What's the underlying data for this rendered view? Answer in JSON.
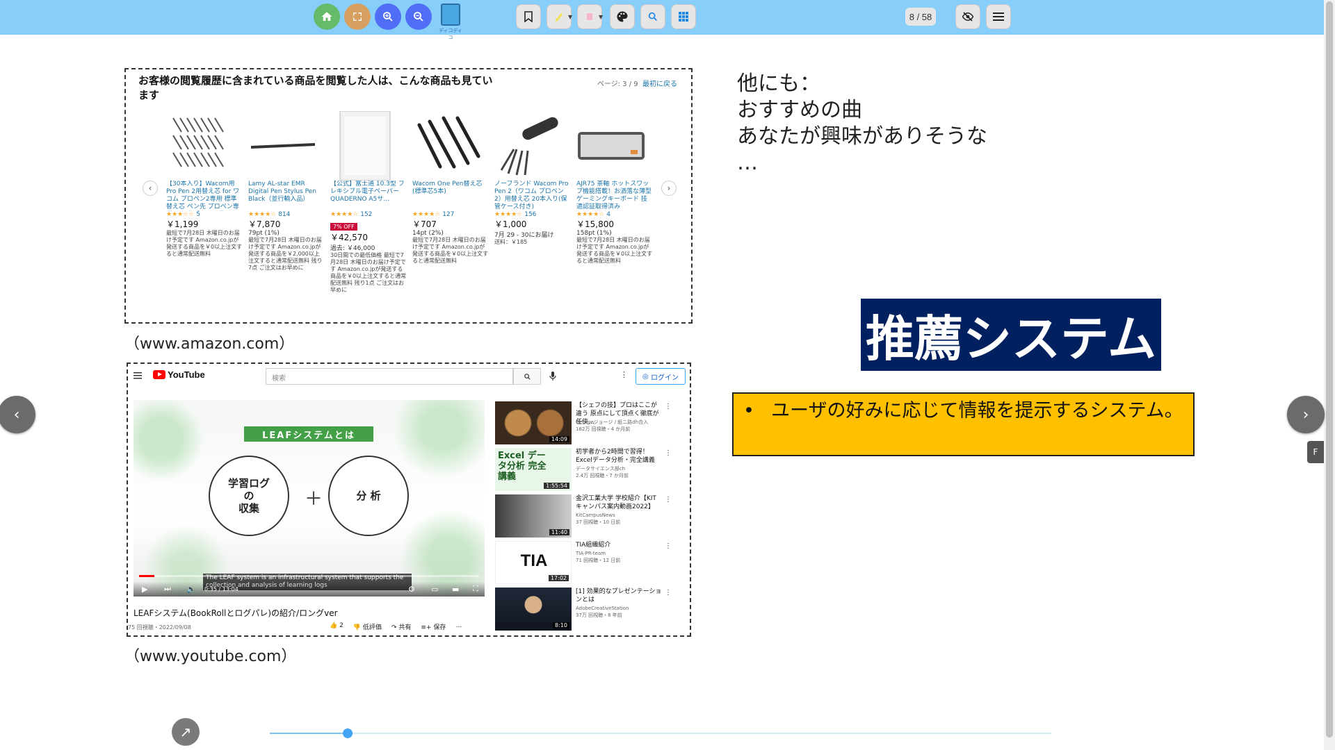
{
  "toolbar": {
    "home_icon": "home-icon",
    "fullscreen_icon": "fullscreen-icon",
    "zoom_in_icon": "zoom-in-icon",
    "zoom_out_icon": "zoom-out-icon",
    "logo_text": "ディコディコ",
    "page_indicator": "8 / 58",
    "colors": {
      "bar": "#87cefa",
      "home": "#66bb6a",
      "fullscreen": "#d8a060",
      "zoom": "#4f6df5"
    }
  },
  "amazon": {
    "heading": "お客様の閲覧履歴に含まれている商品を閲覧した人は、こんな商品も見ています",
    "page_label": "ページ: 3 / 9",
    "back_link": "最初に戻る",
    "items": [
      {
        "name": "【30本入り】Wacom用 Pro Pen 2用替え芯 for ワコム プロペン2専用 標準 替え芯 ペン先 プロペン専用 ペンタブレット用…",
        "stars": "★★★☆☆",
        "reviews": "5",
        "price": "￥1,199",
        "points": "",
        "notes": "最短で7月28日 木曜日のお届け予定です Amazon.co.jpが発送する商品を￥0以上注文すると通常配送無料"
      },
      {
        "name": "Lamy AL-star EMR Digital Pen Stylus Pen Black（並行輸入品）",
        "stars": "★★★★☆",
        "reviews": "814",
        "price": "￥7,870",
        "points": "79pt (1%)",
        "notes": "最短で7月28日 木曜日のお届け予定です Amazon.co.jpが発送する商品を￥2,000以上注文すると通常配送無料 残り7点 ご注文はお早めに"
      },
      {
        "name": "【公式】富士通 10.3型 フレキシブル電子ペーパー QUADERNO A5サ…",
        "stars": "★★★★☆",
        "reviews": "152",
        "badge": "7% OFF",
        "price": "￥42,570",
        "points": "過去: ￥46,000",
        "notes": "30日間での最低価格 最短で7月28日 木曜日のお届け予定です Amazon.co.jpが発送する商品を￥0以上注文すると通常配送無料 残り1点 ご注文はお早めに"
      },
      {
        "name": "Wacom One Pen替え芯 (標準芯5本)",
        "stars": "★★★★☆",
        "reviews": "127",
        "price": "￥707",
        "points": "14pt (2%)",
        "notes": "最短で7月28日 木曜日のお届け予定です Amazon.co.jpが発送する商品を￥0以上注文すると通常配送無料"
      },
      {
        "name": "ノーブランド Wacom Pro Pen 2（ワコム プロペン 2）用替え芯 20本入り(保管ケース付き)",
        "stars": "★★★★☆",
        "reviews": "156",
        "price": "￥1,000",
        "points": "7月 29 - 30にお届け",
        "notes": "送料：￥185"
      },
      {
        "name": "AJR75 茶軸 ホットスワップ機能搭載！お洒落な薄型ゲーミングキーボード 技適認証取得済み",
        "stars": "★★★★☆",
        "reviews": "4",
        "price": "￥15,800",
        "points": "158pt (1%)",
        "notes": "最短で7月28日 木曜日のお届け予定です Amazon.co.jpが発送する商品を￥0以上注文すると通常配送無料"
      }
    ],
    "caption": "（www.amazon.com）"
  },
  "youtube": {
    "logo": "YouTube",
    "search_placeholder": "検索",
    "login": "ログイン",
    "slide_band": "LEAFシステムとは",
    "circle_left": "学習ログ\nの\n収集",
    "plus": "＋",
    "circle_right": "分 析",
    "subtitle": "The LEAF system is an infrastructural system that supports the collection and analysis of learning logs",
    "time": "0:35 / 13:04",
    "progress": 0.045,
    "video_title": "LEAFシステム(BookRollとログパレ)の紹介/ロングver",
    "views_date": "75 回視聴・2022/09/08",
    "actions": {
      "like": "2",
      "dislike": "低評価",
      "share": "共有",
      "save": "保存",
      "more": "…"
    },
    "related": [
      {
        "title": "【シェフの技】プロはここが違う 原点にして頂点く徹底が任侠…",
        "channel": "Georgeジョージ / 紙ニ路dh合入",
        "stats": "182万 回視聴・4 か月前",
        "duration": "14:09"
      },
      {
        "title": "初学者から2時間で習得！Excelデータ分析・完全講義",
        "channel": "データサイエンス部ch",
        "stats": "2.4万 回視聴・7 か月前",
        "duration": "1:55:54",
        "thumb_text": "Excel データ分析 完全講義"
      },
      {
        "title": "金沢工業大学 学校紹介【KITキャンパス案内動画2022】",
        "channel": "KitCampusNews",
        "stats": "37 回視聴・10 日前",
        "duration": "11:40"
      },
      {
        "title": "TIA組織紹介",
        "channel": "TIA-PR-team",
        "stats": "71 回視聴・12 日前",
        "duration": "17:02",
        "thumb_text": "TIA"
      },
      {
        "title": "[1] 効果的なプレゼンテーションとは",
        "channel": "AdobeCreativeStation",
        "stats": "37万 回視聴・8 年前",
        "duration": "8:10"
      }
    ],
    "caption": "（www.youtube.com）"
  },
  "slide": {
    "others_lines": [
      "他にも：",
      "おすすめの曲",
      "あなたが興味がありそうな",
      "…"
    ],
    "title": "推薦システム",
    "bullet": "•",
    "definition": "ユーザの好みに応じて情報を提示するシステム。"
  },
  "navigation": {
    "prev": "‹",
    "next": "›",
    "side_tab": "F",
    "page_slider_position": 0.1,
    "fab_icon": "↗"
  }
}
